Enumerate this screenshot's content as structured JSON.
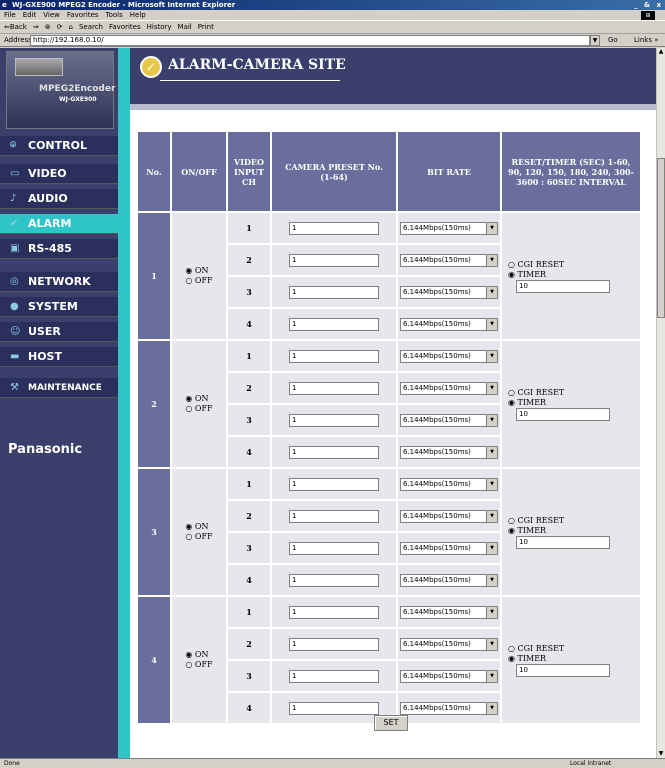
{
  "window": {
    "title": "WJ-GXE900 MPEG2 Encoder - Microsoft Internet Explorer",
    "controls": "_ & x"
  },
  "menu": [
    "File",
    "Edit",
    "View",
    "Favorites",
    "Tools",
    "Help"
  ],
  "toolbar": [
    "⇐Back",
    "⇒",
    "⊗",
    "⟳",
    "⌂",
    "Search",
    "Favorites",
    "History",
    "Mail",
    "Print"
  ],
  "address": {
    "label": "Address",
    "value": "http://192.168.0.10/",
    "go": "Go",
    "links": "Links »"
  },
  "status": {
    "text": "Done",
    "zone": "Local intranet"
  },
  "logo": {
    "line1": "MPEG2Encoder",
    "line2": "WJ-GXE900"
  },
  "nav": [
    {
      "label": "CONTROL",
      "icon": "camera-icon"
    },
    {
      "label": "VIDEO",
      "icon": "video-icon"
    },
    {
      "label": "AUDIO",
      "icon": "audio-icon"
    },
    {
      "label": "ALARM",
      "icon": "alarm-icon",
      "active": true
    },
    {
      "label": "RS-485",
      "icon": "rs485-icon"
    },
    {
      "label": "NETWORK",
      "icon": "network-icon"
    },
    {
      "label": "SYSTEM",
      "icon": "system-icon"
    },
    {
      "label": "USER",
      "icon": "user-icon"
    },
    {
      "label": "HOST",
      "icon": "host-icon"
    },
    {
      "label": "MAINTENANCE",
      "icon": "maintenance-icon"
    }
  ],
  "brand": "Panasonic",
  "page_title": "ALARM-CAMERA SITE",
  "table": {
    "headers": [
      "No.",
      "ON/OFF",
      "VIDEO INPUT CH",
      "CAMERA PRESET No. (1-64)",
      "BIT RATE",
      "RESET/TIMER (SEC) 1-60, 90, 120, 150, 180, 240, 300-3600 : 60SEC INTERVAL"
    ],
    "on_label": "ON",
    "off_label": "OFF",
    "cgi_reset_label": "CGI RESET",
    "timer_label": "TIMER",
    "groups": [
      {
        "no": "1",
        "timer_value": "10",
        "rows": [
          {
            "ch": "1",
            "preset": "1",
            "bitrate": "6.144Mbps(150ms)"
          },
          {
            "ch": "2",
            "preset": "1",
            "bitrate": "6.144Mbps(150ms)"
          },
          {
            "ch": "3",
            "preset": "1",
            "bitrate": "6.144Mbps(150ms)"
          },
          {
            "ch": "4",
            "preset": "1",
            "bitrate": "6.144Mbps(150ms)"
          }
        ]
      },
      {
        "no": "2",
        "timer_value": "10",
        "rows": [
          {
            "ch": "1",
            "preset": "1",
            "bitrate": "6.144Mbps(150ms)"
          },
          {
            "ch": "2",
            "preset": "1",
            "bitrate": "6.144Mbps(150ms)"
          },
          {
            "ch": "3",
            "preset": "1",
            "bitrate": "6.144Mbps(150ms)"
          },
          {
            "ch": "4",
            "preset": "1",
            "bitrate": "6.144Mbps(150ms)"
          }
        ]
      },
      {
        "no": "3",
        "timer_value": "10",
        "rows": [
          {
            "ch": "1",
            "preset": "1",
            "bitrate": "6.144Mbps(150ms)"
          },
          {
            "ch": "2",
            "preset": "1",
            "bitrate": "6.144Mbps(150ms)"
          },
          {
            "ch": "3",
            "preset": "1",
            "bitrate": "6.144Mbps(150ms)"
          },
          {
            "ch": "4",
            "preset": "1",
            "bitrate": "6.144Mbps(150ms)"
          }
        ]
      },
      {
        "no": "4",
        "timer_value": "10",
        "rows": [
          {
            "ch": "1",
            "preset": "1",
            "bitrate": "6.144Mbps(150ms)"
          },
          {
            "ch": "2",
            "preset": "1",
            "bitrate": "6.144Mbps(150ms)"
          },
          {
            "ch": "3",
            "preset": "1",
            "bitrate": "6.144Mbps(150ms)"
          },
          {
            "ch": "4",
            "preset": "1",
            "bitrate": "6.144Mbps(150ms)"
          }
        ]
      }
    ]
  },
  "set_button": "SET"
}
